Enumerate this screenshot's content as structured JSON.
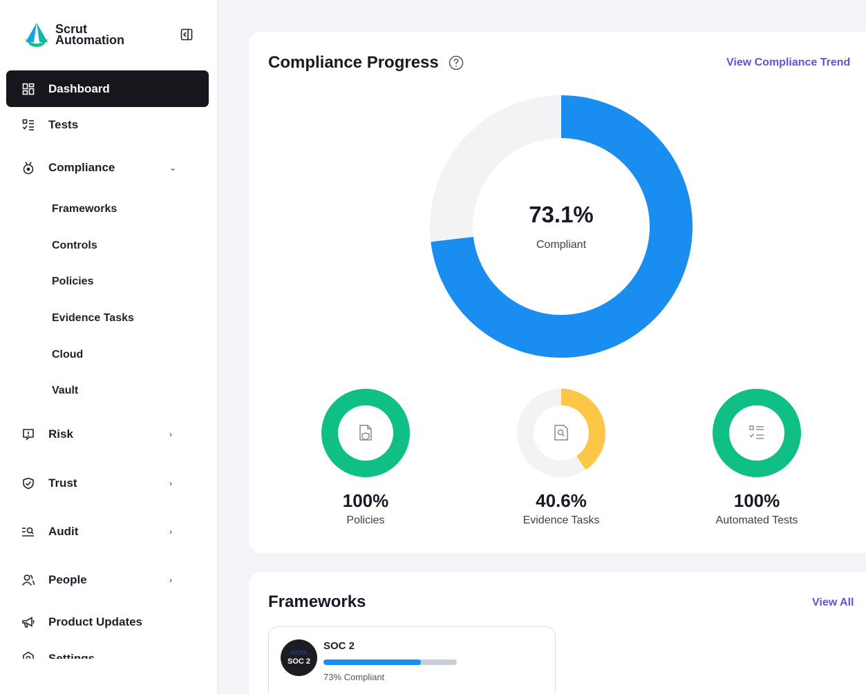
{
  "brand": {
    "line1": "Scrut",
    "line2": "Automation"
  },
  "sidebar": {
    "items": [
      {
        "label": "Dashboard",
        "icon": "dashboard-icon",
        "active": true
      },
      {
        "label": "Tests",
        "icon": "tests-icon"
      },
      {
        "label": "Compliance",
        "icon": "compliance-icon",
        "chevron": "down"
      },
      {
        "label": "Risk",
        "icon": "risk-icon",
        "chevron": "right"
      },
      {
        "label": "Trust",
        "icon": "trust-icon",
        "chevron": "right"
      },
      {
        "label": "Audit",
        "icon": "audit-icon",
        "chevron": "right"
      },
      {
        "label": "People",
        "icon": "people-icon",
        "chevron": "right"
      },
      {
        "label": "Product Updates",
        "icon": "megaphone-icon"
      },
      {
        "label": "Settings",
        "icon": "settings-icon"
      }
    ],
    "compliance_sub": [
      "Frameworks",
      "Controls",
      "Policies",
      "Evidence Tasks",
      "Cloud",
      "Vault"
    ]
  },
  "progress": {
    "title": "Compliance Progress",
    "trend_link": "View Compliance Trend",
    "overall_value": "73.1%",
    "overall_label": "Compliant",
    "overall_fraction": 0.731,
    "metrics": [
      {
        "value": "100%",
        "label": "Policies",
        "fraction": 1.0,
        "color": "#0fbf86",
        "icon": "policy-document-icon"
      },
      {
        "value": "40.6%",
        "label": "Evidence Tasks",
        "fraction": 0.406,
        "color": "#fcc646",
        "icon": "evidence-search-icon"
      },
      {
        "value": "100%",
        "label": "Automated Tests",
        "fraction": 1.0,
        "color": "#0fbf86",
        "icon": "checklist-icon"
      }
    ]
  },
  "frameworks": {
    "title": "Frameworks",
    "view_all": "View All",
    "cards": [
      {
        "name": "SOC 2",
        "badge_top": "AICPA",
        "badge_bottom": "SOC 2",
        "fraction": 0.73,
        "caption": "73% Compliant"
      }
    ]
  },
  "colors": {
    "primary_blue": "#1a8df0",
    "track": "#f3f3f6",
    "accent_link": "#5b55d6"
  }
}
